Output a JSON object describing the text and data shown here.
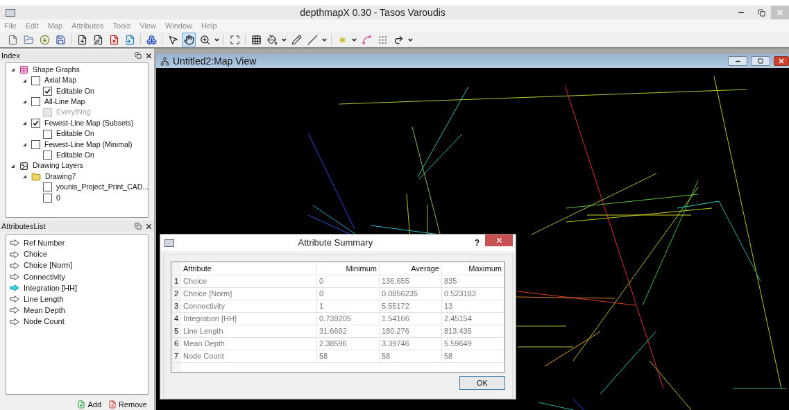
{
  "window": {
    "title": "depthmapX 0.30 - Tasos Varoudis"
  },
  "menu": [
    "File",
    "Edit",
    "Map",
    "Attributes",
    "Tools",
    "View",
    "Window",
    "Help"
  ],
  "toolbar": [
    {
      "kind": "new",
      "selected": false
    },
    {
      "kind": "open",
      "selected": false
    },
    {
      "kind": "import",
      "selected": false
    },
    {
      "kind": "save",
      "selected": false
    },
    {
      "kind": "sep"
    },
    {
      "kind": "add-column",
      "selected": false
    },
    {
      "kind": "edit-column",
      "selected": false
    },
    {
      "kind": "remove-column",
      "selected": false
    },
    {
      "kind": "push",
      "selected": false
    },
    {
      "kind": "sep"
    },
    {
      "kind": "attribute-summary",
      "selected": false
    },
    {
      "kind": "sep"
    },
    {
      "kind": "select",
      "selected": false
    },
    {
      "kind": "pan",
      "selected": true
    },
    {
      "kind": "zoom",
      "selected": false
    },
    {
      "kind": "dropdown"
    },
    {
      "kind": "sep"
    },
    {
      "kind": "fit",
      "selected": false
    },
    {
      "kind": "sep"
    },
    {
      "kind": "grid",
      "selected": false
    },
    {
      "kind": "fill",
      "selected": false
    },
    {
      "kind": "dropdown"
    },
    {
      "kind": "pencil",
      "selected": false
    },
    {
      "kind": "line",
      "selected": false
    },
    {
      "kind": "dropdown"
    },
    {
      "kind": "sep"
    },
    {
      "kind": "isovist",
      "selected": false
    },
    {
      "kind": "dropdown"
    },
    {
      "kind": "axial",
      "selected": false
    },
    {
      "kind": "points",
      "selected": false
    },
    {
      "kind": "step",
      "selected": false
    },
    {
      "kind": "dropdown"
    }
  ],
  "index": {
    "title": "Index",
    "tree": [
      {
        "kind": "graphs",
        "label": "Shape Graphs",
        "expanded": true,
        "children": [
          {
            "kind": "checkbox",
            "label": "Axial Map",
            "checked": false,
            "disabled": false,
            "expanded": true,
            "children": [
              {
                "kind": "checkbox",
                "label": "Editable On",
                "checked": true,
                "disabled": false
              }
            ]
          },
          {
            "kind": "checkbox",
            "label": "All-Line Map",
            "checked": false,
            "disabled": false,
            "expanded": true,
            "children": [
              {
                "kind": "checkbox",
                "label": "Everything",
                "checked": false,
                "disabled": true
              }
            ]
          },
          {
            "kind": "checkbox",
            "label": "Fewest-Line Map (Subsets)",
            "checked": true,
            "disabled": false,
            "expanded": true,
            "children": [
              {
                "kind": "checkbox",
                "label": "Editable On",
                "checked": false,
                "disabled": false
              }
            ]
          },
          {
            "kind": "checkbox",
            "label": "Fewest-Line Map (Minimal)",
            "checked": false,
            "disabled": false,
            "expanded": true,
            "children": [
              {
                "kind": "checkbox",
                "label": "Editable On",
                "checked": false,
                "disabled": false
              }
            ]
          }
        ]
      },
      {
        "kind": "layers",
        "label": "Drawing Layers",
        "expanded": true,
        "children": [
          {
            "kind": "folder",
            "label": "Drawing7",
            "expanded": true,
            "children": [
              {
                "kind": "checkbox",
                "label": "younis_Project_Print_CAD...",
                "checked": false,
                "disabled": false
              },
              {
                "kind": "checkbox",
                "label": "0",
                "checked": false,
                "disabled": false
              }
            ]
          }
        ]
      }
    ]
  },
  "attributes_list": {
    "title": "AttributesList",
    "items": [
      {
        "label": "Ref Number",
        "selected": false
      },
      {
        "label": "Choice",
        "selected": false
      },
      {
        "label": "Choice [Norm]",
        "selected": false
      },
      {
        "label": "Connectivity",
        "selected": false
      },
      {
        "label": "Integration [HH]",
        "selected": true
      },
      {
        "label": "Line Length",
        "selected": false
      },
      {
        "label": "Mean Depth",
        "selected": false
      },
      {
        "label": "Node Count",
        "selected": false
      }
    ],
    "buttons": [
      "Add",
      "Remove"
    ]
  },
  "map_view": {
    "title": "Untitled2:Map View"
  },
  "dialog": {
    "title": "Attribute Summary",
    "help": "?",
    "columns": [
      "Attribute",
      "Minimum",
      "Average",
      "Maximum"
    ],
    "rows": [
      {
        "index": "1",
        "cells": [
          "Choice",
          "0",
          "136.655",
          "835"
        ]
      },
      {
        "index": "2",
        "cells": [
          "Choice [Norm]",
          "0",
          "0.0856235",
          "0.523183"
        ]
      },
      {
        "index": "3",
        "cells": [
          "Connectivity",
          "1",
          "5.55172",
          "13"
        ]
      },
      {
        "index": "4",
        "cells": [
          "Integration [HH]",
          "0.739205",
          "1.54166",
          "2.45154"
        ]
      },
      {
        "index": "5",
        "cells": [
          "Line Length",
          "31.6692",
          "180.276",
          "813.435"
        ]
      },
      {
        "index": "6",
        "cells": [
          "Mean Depth",
          "2.38596",
          "3.39746",
          "5.59649"
        ]
      },
      {
        "index": "7",
        "cells": [
          "Node Count",
          "58",
          "58",
          "58"
        ]
      }
    ],
    "ok": "OK"
  }
}
